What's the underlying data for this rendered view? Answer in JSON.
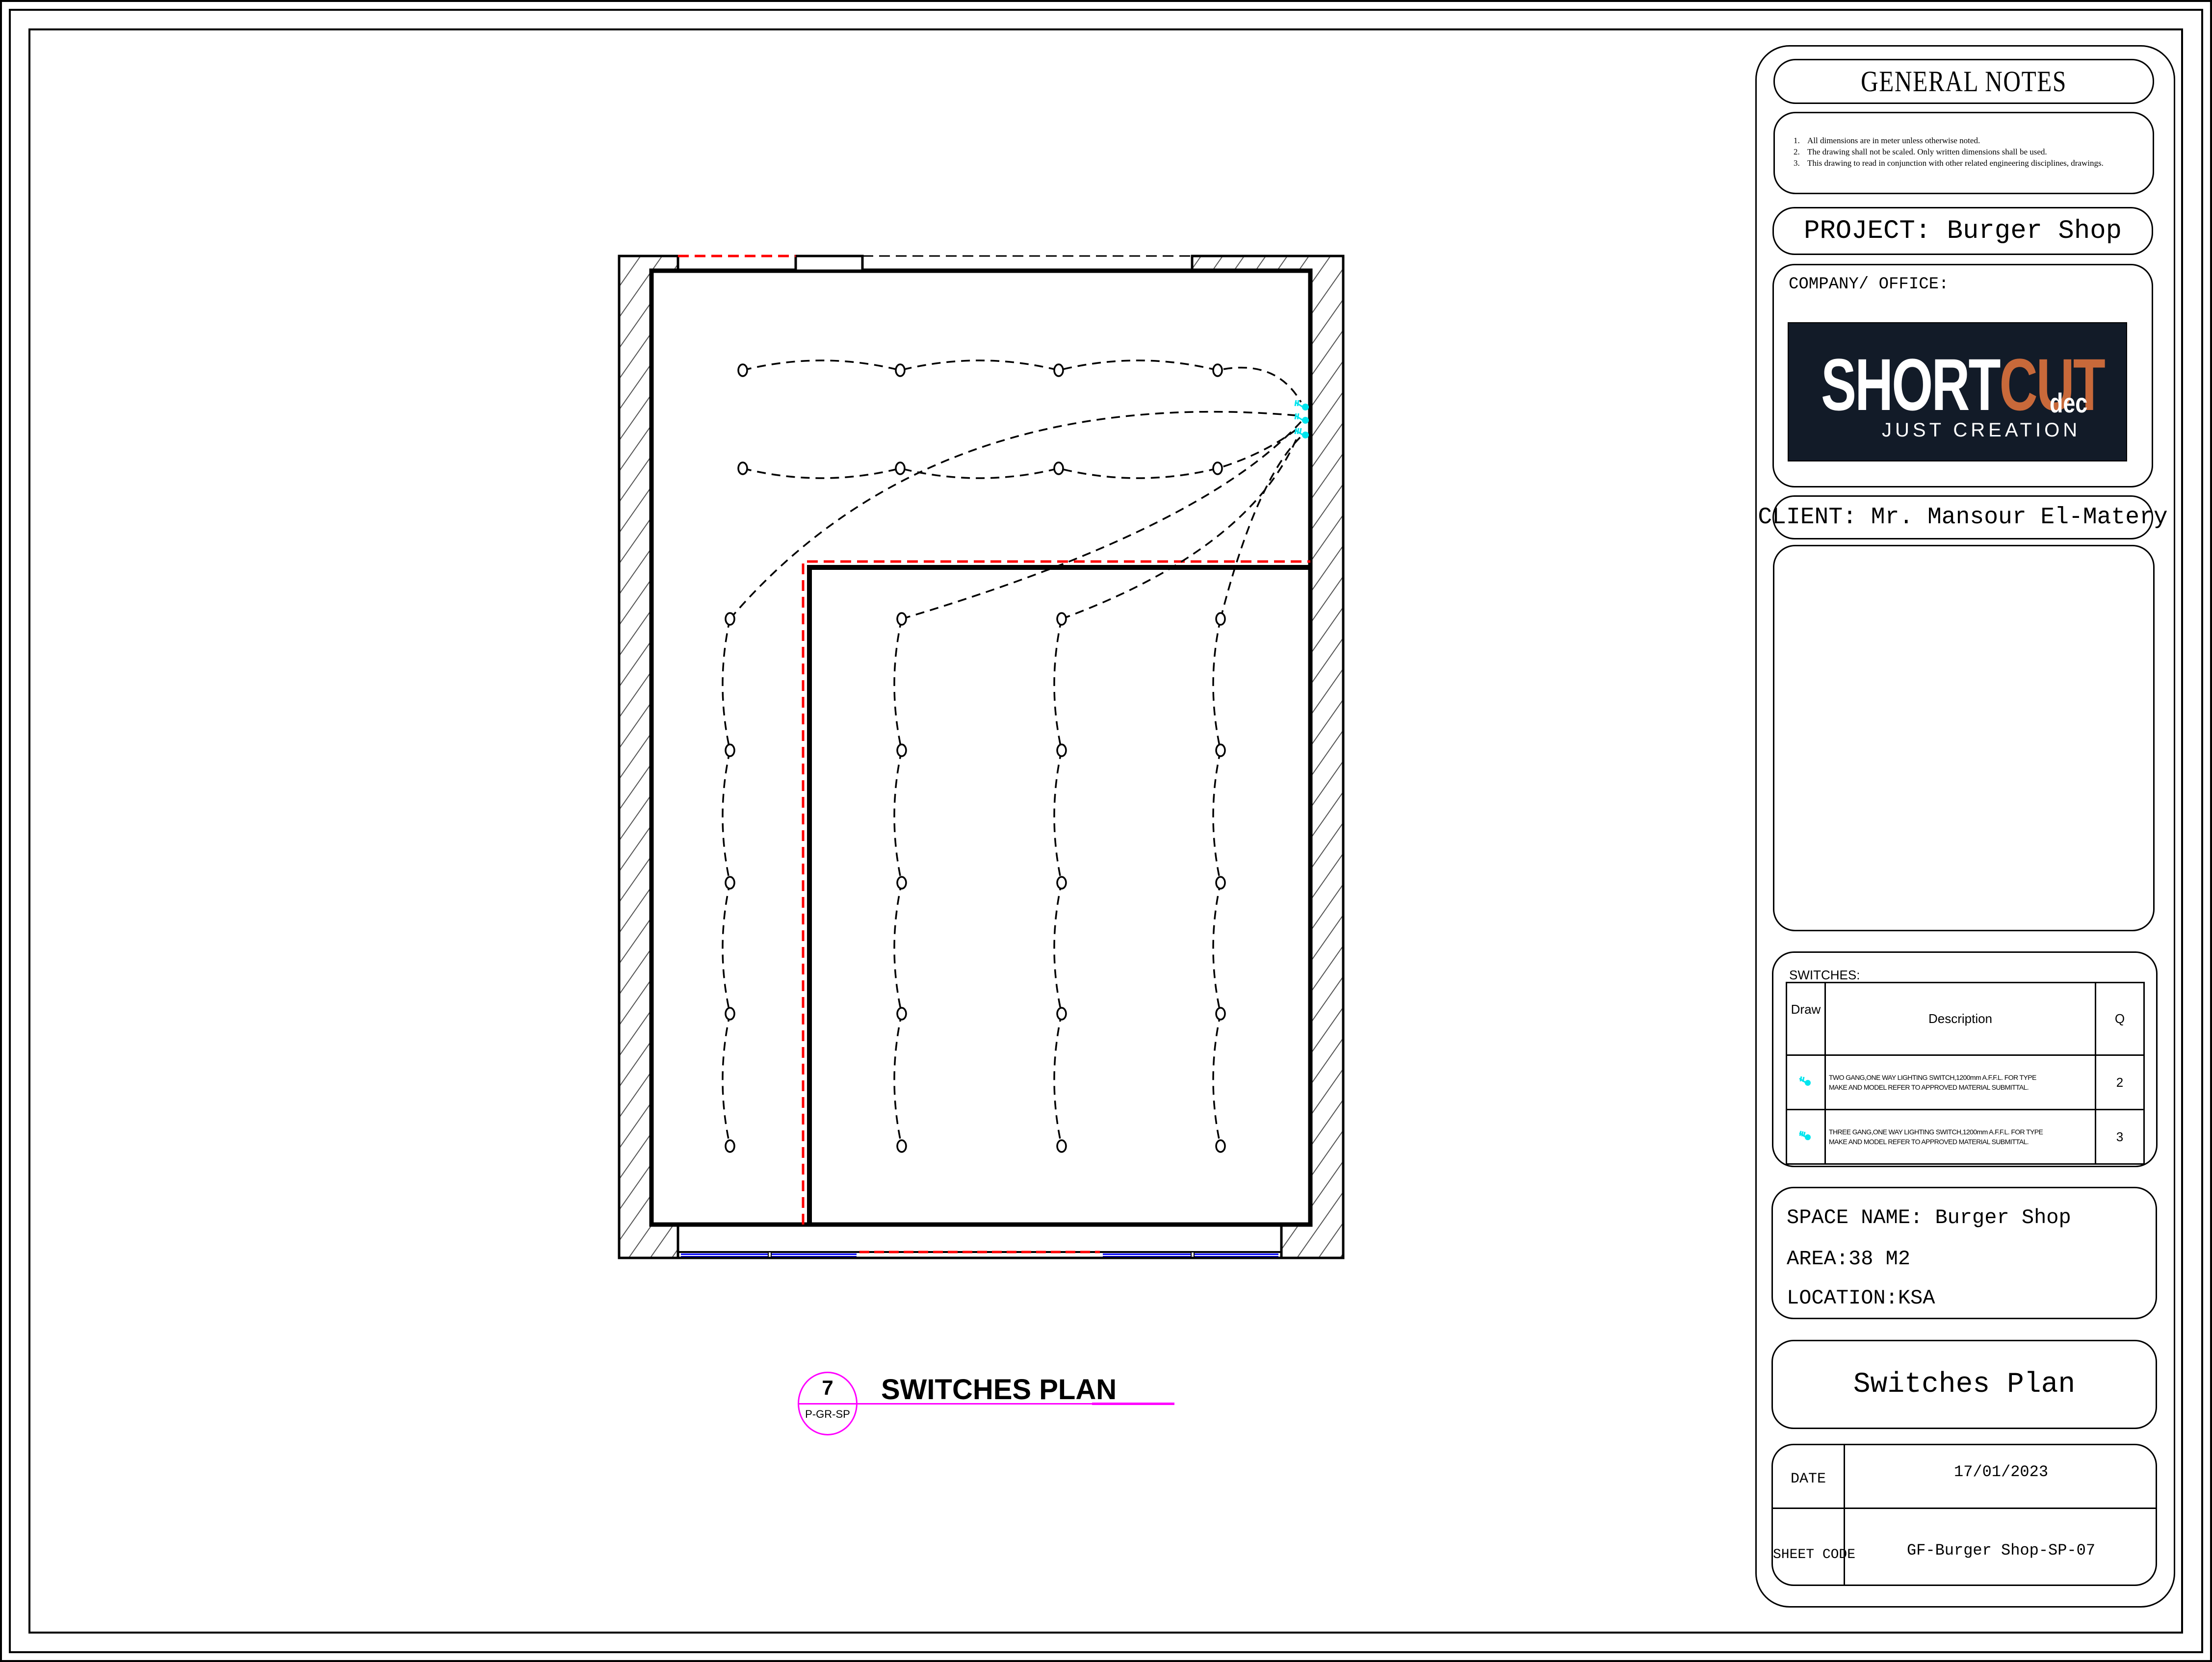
{
  "drawing": {
    "number": "7",
    "sheet_ref": "P-GR-SP",
    "title": "SWITCHES PLAN"
  },
  "title_block": {
    "general_notes_title": "GENERAL NOTES",
    "general_notes": [
      "All dimensions are in meter unless otherwise noted.",
      "The drawing shall not be scaled. Only written dimensions shall be used.",
      "This drawing to read in conjunction with other related engineering disciplines, drawings."
    ],
    "project": "PROJECT: Burger Shop",
    "company_label": "COMPANY/ OFFICE:",
    "logo": {
      "word_white": "SHORT",
      "word_accent": "CUT",
      "suffix": "dec",
      "tagline": "JUST CREATION",
      "bg_color": "#121b28",
      "accent_color": "#c8693a"
    },
    "client": "CLIENT: Mr. Mansour El-Matery",
    "switches": {
      "label": "SWITCHES:",
      "headers": {
        "draw": "Draw",
        "description": "Description",
        "qty": "Q"
      },
      "rows": [
        {
          "symbol": "two-gang-switch-icon",
          "description_line1": "TWO GANG,ONE WAY LIGHTING SWITCH,1200mm A.F.F.L. FOR TYPE",
          "description_line2": "MAKE AND MODEL REFER TO APPROVED MATERIAL SUBMITTAL.",
          "qty": "2"
        },
        {
          "symbol": "three-gang-switch-icon",
          "description_line1": "THREE GANG,ONE WAY LIGHTING SWITCH,1200mm A.F.F.L. FOR TYPE",
          "description_line2": "MAKE AND MODEL REFER TO APPROVED MATERIAL SUBMITTAL.",
          "qty": "3"
        }
      ]
    },
    "space_name": "SPACE NAME: Burger Shop",
    "area": "AREA:38 M2",
    "location": "LOCATION:KSA",
    "sheet_title": "Switches Plan",
    "date_label": "DATE",
    "date_value": "17/01/2023",
    "sheet_code_label": "SHEET CODE",
    "sheet_code_value": "GF-Burger Shop-SP-07"
  },
  "colors": {
    "switch": "#00e5ee",
    "hidden_line": "#ff0000",
    "glazing": "#0000ff",
    "label_line": "#ff00ff",
    "hatch": "#555555"
  }
}
